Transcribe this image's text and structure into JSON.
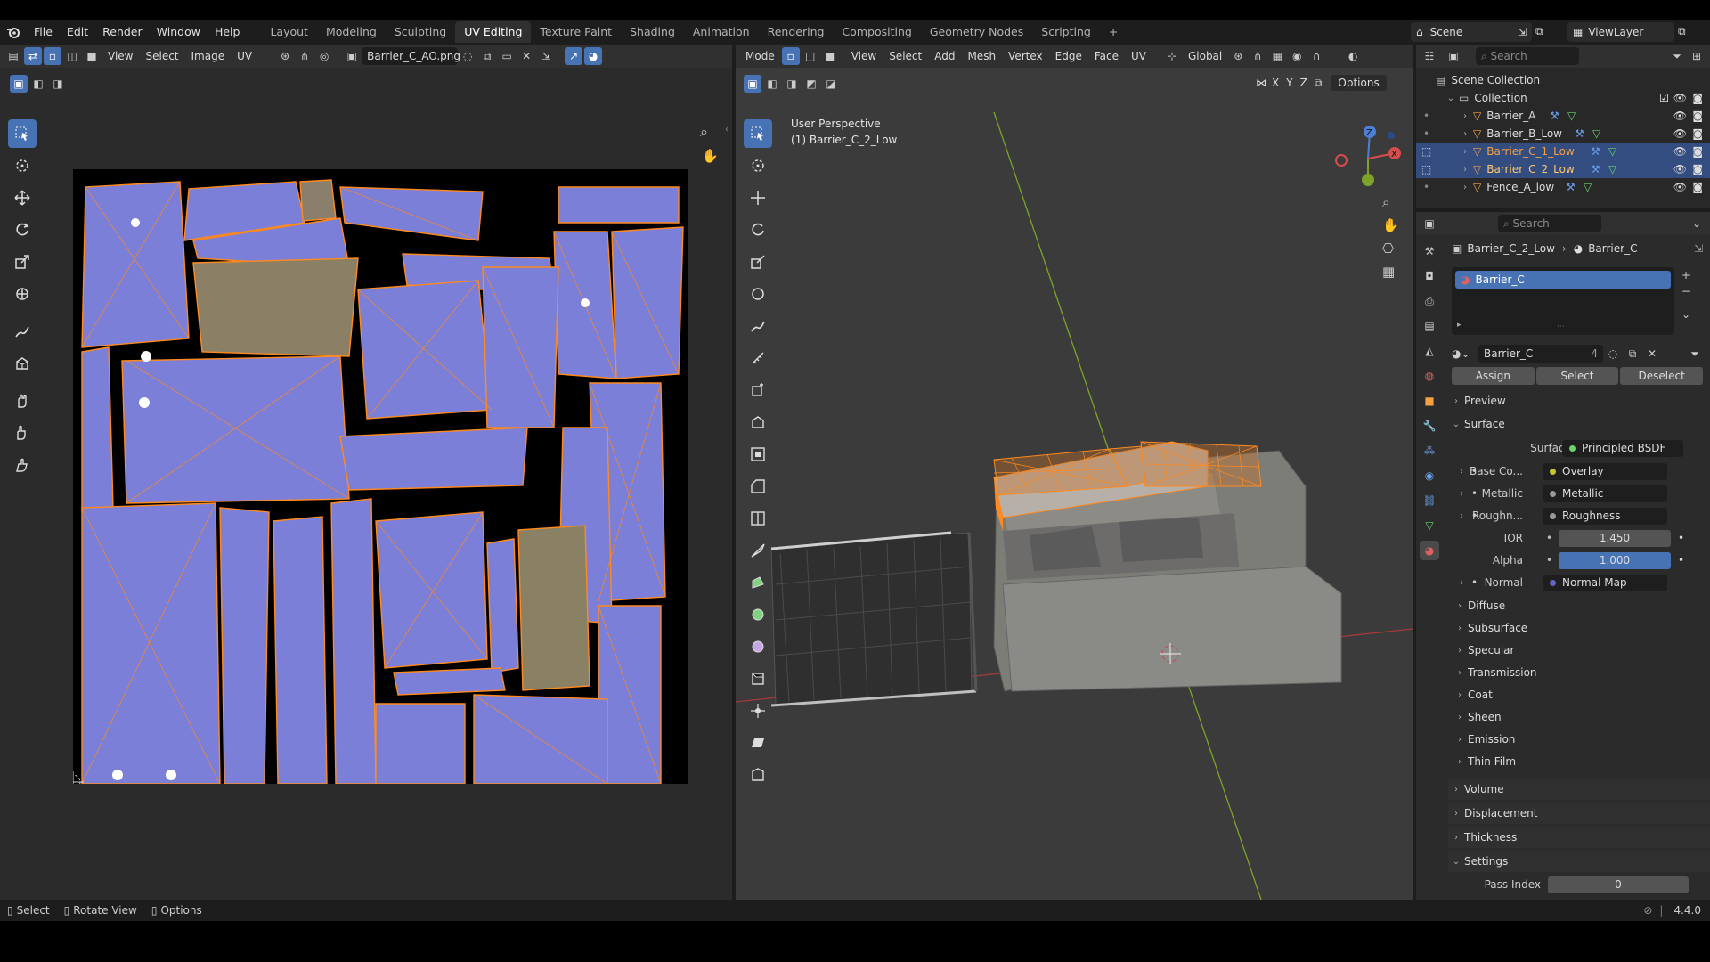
{
  "menu": {
    "file": "File",
    "edit": "Edit",
    "render": "Render",
    "window": "Window",
    "help": "Help"
  },
  "workspaces": [
    "Layout",
    "Modeling",
    "Sculpting",
    "UV Editing",
    "Texture Paint",
    "Shading",
    "Animation",
    "Rendering",
    "Compositing",
    "Geometry Nodes",
    "Scripting"
  ],
  "active_workspace": "UV Editing",
  "scene": {
    "label": "Scene",
    "view_layer": "ViewLayer"
  },
  "uv_editor": {
    "menus": {
      "view": "View",
      "select": "Select",
      "image": "Image",
      "uv": "UV"
    },
    "image_name": "Barrier_C_AO.png"
  },
  "viewport": {
    "mode": "Mode",
    "menus": {
      "view": "View",
      "select": "Select",
      "add": "Add",
      "mesh": "Mesh",
      "vertex": "Vertex",
      "edge": "Edge",
      "face": "Face",
      "uv": "UV"
    },
    "orientation": "Global",
    "options": "Options",
    "axes": {
      "x": "X",
      "y": "Y",
      "z": "Z"
    },
    "overlay_line1": "User Perspective",
    "overlay_line2": "(1) Barrier_C_2_Low"
  },
  "outliner": {
    "search_placeholder": "Search",
    "scene_collection": "Scene Collection",
    "collection": "Collection",
    "items": [
      "Barrier_A",
      "Barrier_B_Low",
      "Barrier_C_1_Low",
      "Barrier_C_2_Low",
      "Fence_A_low"
    ]
  },
  "properties": {
    "search_placeholder": "Search",
    "breadcrumb_object": "Barrier_C_2_Low",
    "breadcrumb_material": "Barrier_C",
    "slot_name": "Barrier_C",
    "material_name": "Barrier_C",
    "user_count": "4",
    "assign": "Assign",
    "select": "Select",
    "deselect": "Deselect",
    "preview": "Preview",
    "surface_panel": "Surface",
    "surface_label": "Surface",
    "surface_value": "Principled BSDF",
    "inputs": [
      {
        "label": "Base Co...",
        "value": "Overlay"
      },
      {
        "label": "Metallic",
        "value": "Metallic"
      },
      {
        "label": "Roughn...",
        "value": "Roughness"
      },
      {
        "label": "IOR",
        "value": "1.450"
      },
      {
        "label": "Alpha",
        "value": "1.000"
      },
      {
        "label": "Normal",
        "value": "Normal Map"
      }
    ],
    "subpanels": [
      "Diffuse",
      "Subsurface",
      "Specular",
      "Transmission",
      "Coat",
      "Sheen",
      "Emission",
      "Thin Film"
    ],
    "volume": "Volume",
    "displacement": "Displacement",
    "thickness": "Thickness",
    "settings": "Settings",
    "pass_index_label": "Pass Index",
    "pass_index_value": "0"
  },
  "status": {
    "select": "Select",
    "rotate": "Rotate View",
    "options": "Options",
    "version": "4.4.0"
  },
  "colors": {
    "accent": "#4772b3",
    "uv_island": "#7b7fd8",
    "uv_edge": "#ff8a1f",
    "selected_row": "#334d80"
  }
}
